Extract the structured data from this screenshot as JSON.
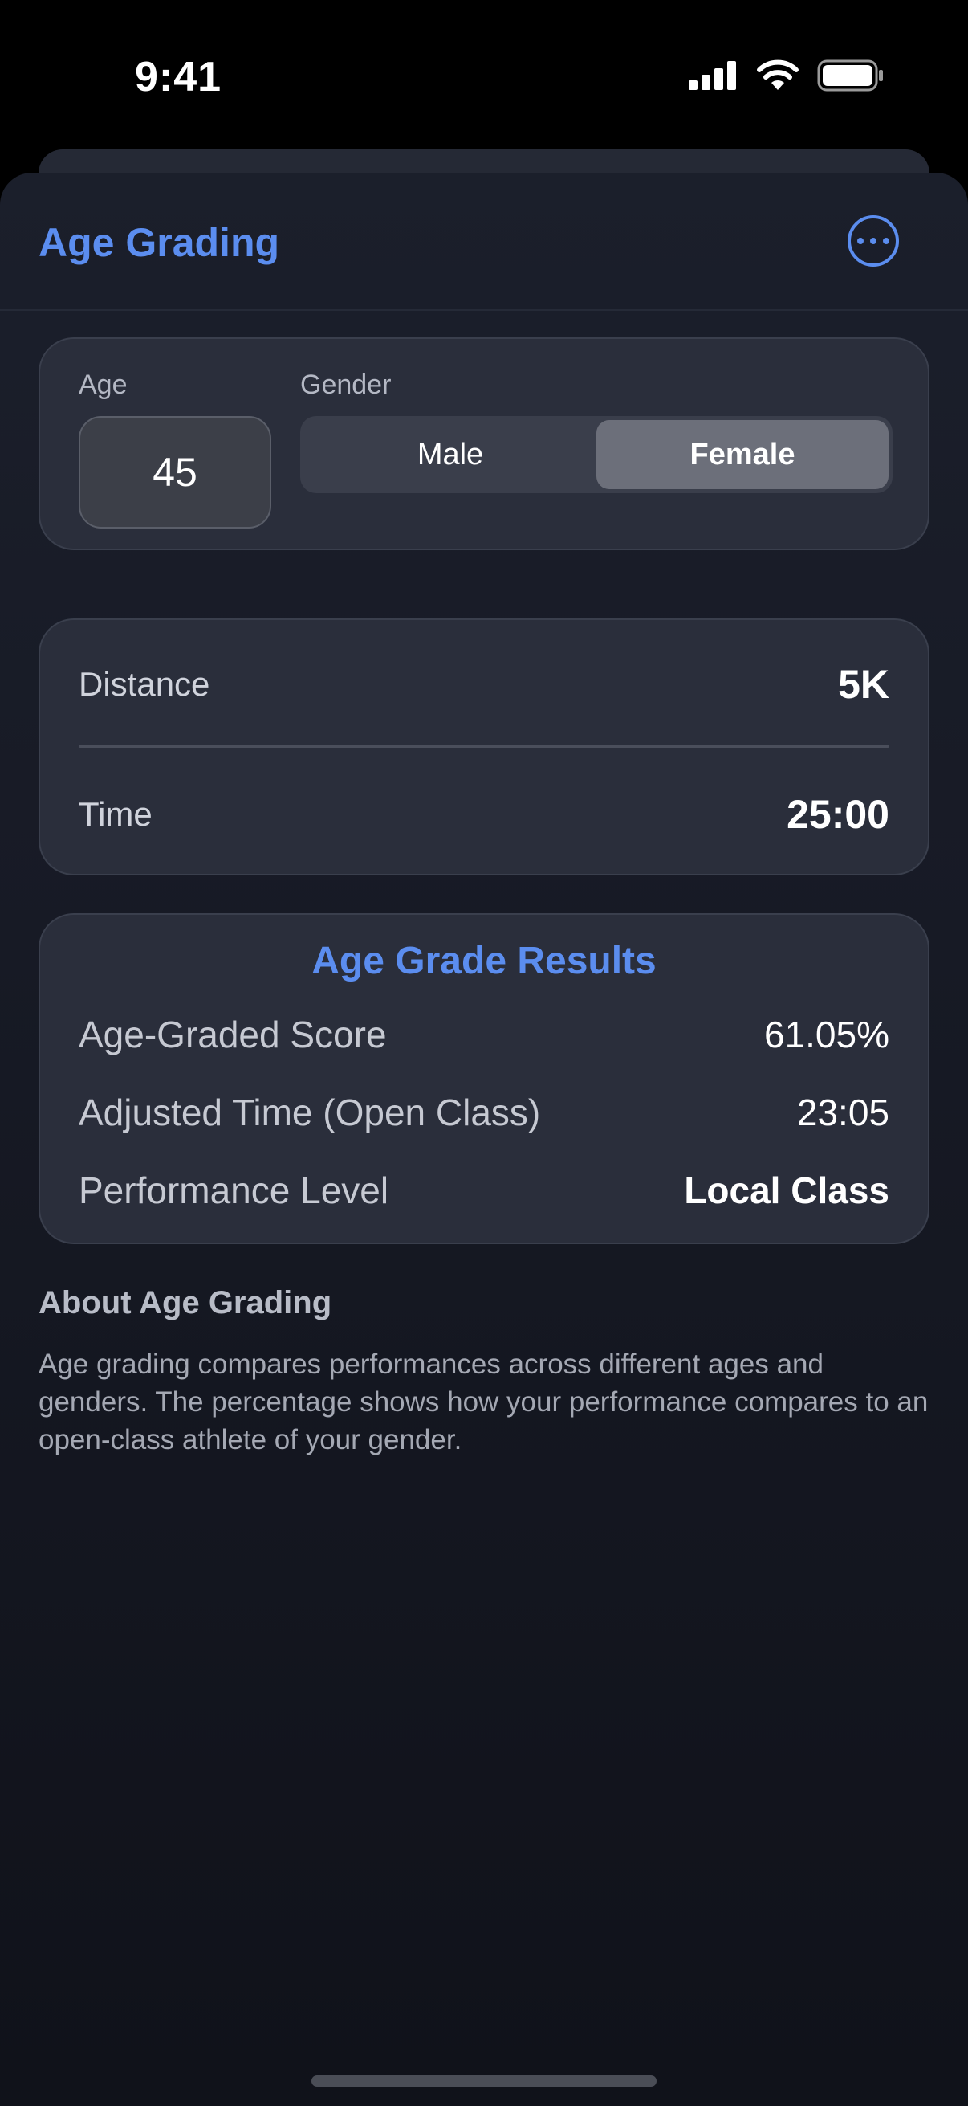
{
  "status_bar": {
    "time": "9:41"
  },
  "nav": {
    "title": "Age Grading"
  },
  "profile": {
    "age_label": "Age",
    "age_value": "45",
    "gender_label": "Gender",
    "gender_options": [
      "Male",
      "Female"
    ],
    "gender_selected": "Female"
  },
  "run": {
    "distance_label": "Distance",
    "distance_value": "5K",
    "time_label": "Time",
    "time_value": "25:00"
  },
  "results": {
    "title": "Age Grade Results",
    "rows": [
      {
        "label": "Age-Graded Score",
        "value": "61.05%"
      },
      {
        "label": "Adjusted Time (Open Class)",
        "value": "23:05"
      },
      {
        "label": "Performance Level",
        "value": "Local Class"
      }
    ]
  },
  "about": {
    "title": "About Age Grading",
    "text": "Age grading compares performances across different ages and genders. The percentage shows how your performance compares to an open-class athlete of your gender."
  },
  "colors": {
    "accent": "#5b8def",
    "card": "#2a2e3b",
    "background": "#10121a"
  }
}
